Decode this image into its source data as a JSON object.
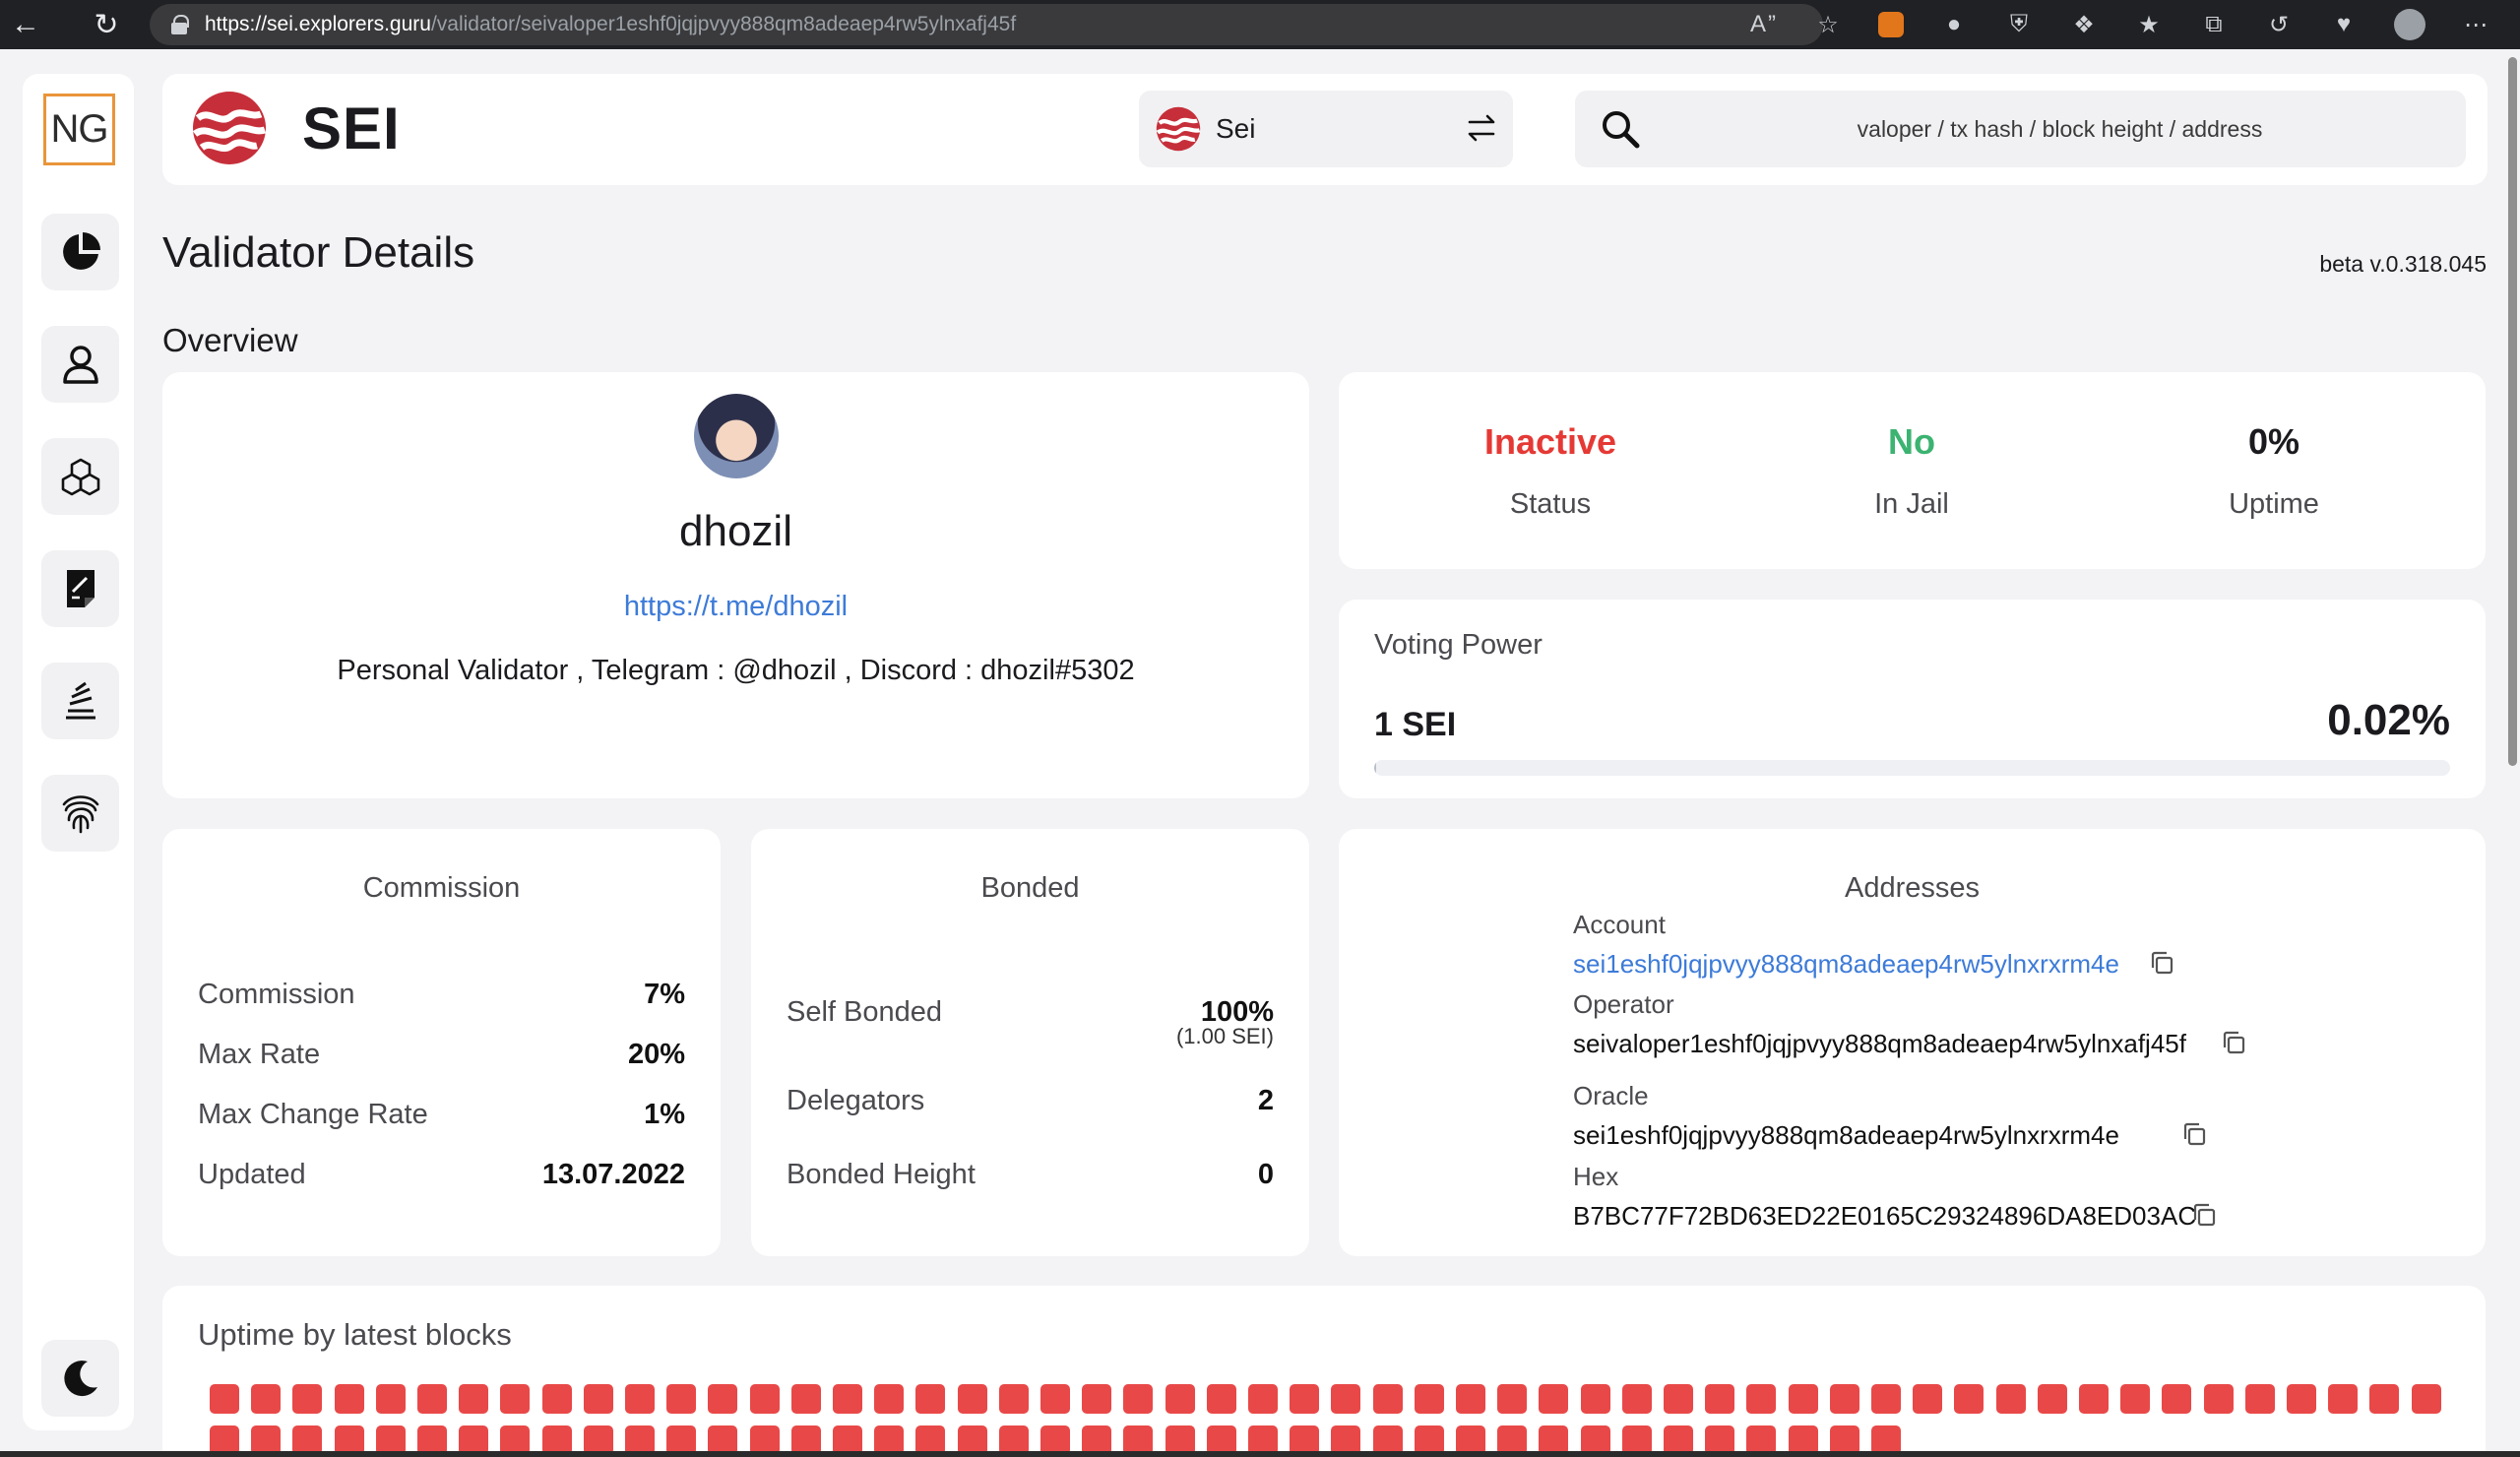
{
  "browser": {
    "url_host": "https://sei.explorers.guru",
    "url_path": "/validator/seivaloper1eshf0jqjpvyy888qm8adeaep4rw5ylnxafj45f"
  },
  "sidebar": {
    "logo_text": "NG",
    "items": [
      {
        "name": "dashboard",
        "icon": "pie-chart-icon"
      },
      {
        "name": "validators",
        "icon": "user-icon"
      },
      {
        "name": "blocks",
        "icon": "cubes-icon"
      },
      {
        "name": "transactions",
        "icon": "document-icon"
      },
      {
        "name": "proposals",
        "icon": "stack-icon"
      },
      {
        "name": "fingerprint",
        "icon": "fingerprint-icon"
      }
    ],
    "theme_toggle_icon": "moon-icon"
  },
  "header": {
    "brand": "SEI",
    "chain_name": "Sei",
    "search_placeholder": "valoper / tx hash / block height / address"
  },
  "page": {
    "title": "Validator Details",
    "version": "beta v.0.318.045",
    "section": "Overview"
  },
  "profile": {
    "moniker": "dhozil",
    "website": "https://t.me/dhozil",
    "details": "Personal Validator , Telegram : @dhozil , Discord : dhozil#5302"
  },
  "status": {
    "status_value": "Inactive",
    "status_label": "Status",
    "jail_value": "No",
    "jail_label": "In Jail",
    "uptime_value": "0%",
    "uptime_label": "Uptime",
    "colors": {
      "inactive": "#e53935",
      "no_jail": "#3cb371"
    }
  },
  "voting_power": {
    "title": "Voting Power",
    "amount": "1 SEI",
    "percent": "0.02%",
    "fraction": 0.0002
  },
  "commission": {
    "title": "Commission",
    "rows": [
      {
        "label": "Commission",
        "value": "7%"
      },
      {
        "label": "Max Rate",
        "value": "20%"
      },
      {
        "label": "Max Change Rate",
        "value": "1%"
      },
      {
        "label": "Updated",
        "value": "13.07.2022"
      }
    ]
  },
  "bonded": {
    "title": "Bonded",
    "self_bonded_label": "Self Bonded",
    "self_bonded_value": "100%",
    "self_bonded_sub": "(1.00 SEI)",
    "delegators_label": "Delegators",
    "delegators_value": "2",
    "height_label": "Bonded Height",
    "height_value": "0"
  },
  "addresses": {
    "title": "Addresses",
    "account_label": "Account",
    "account_value": "sei1eshf0jqjpvyy888qm8adeaep4rw5ylnxrxrm4e",
    "operator_label": "Operator",
    "operator_value": "seivaloper1eshf0jqjpvyy888qm8adeaep4rw5ylnxafj45f",
    "oracle_label": "Oracle",
    "oracle_value": "sei1eshf0jqjpvyy888qm8adeaep4rw5ylnxrxrm4e",
    "hex_label": "Hex",
    "hex_value": "B7BC77F72BD63ED22E0165C29324896DA8ED03AC"
  },
  "uptime_blocks": {
    "title": "Uptime by latest blocks",
    "row1_count": 54,
    "row2_count": 41,
    "missed_color": "#e94848"
  }
}
